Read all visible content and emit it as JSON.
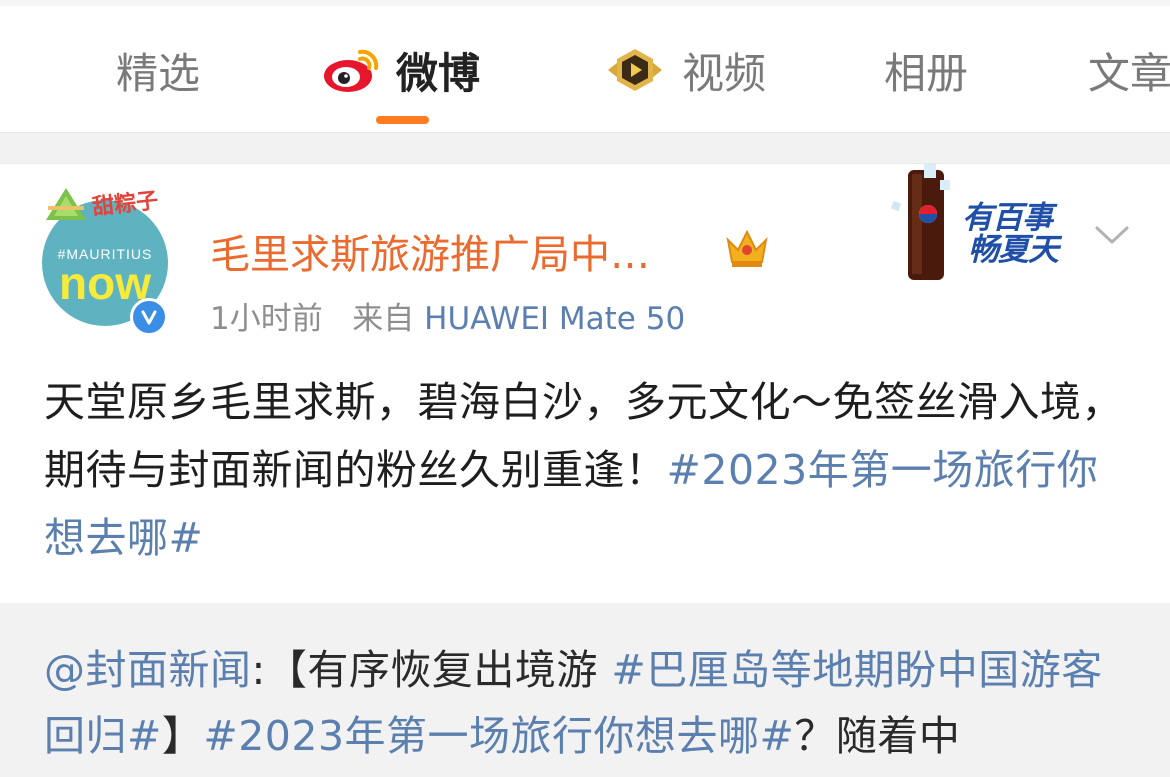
{
  "tabs": [
    {
      "label": "精选",
      "active": false,
      "icon": null
    },
    {
      "label": "微博",
      "active": true,
      "icon": "weibo-logo-icon"
    },
    {
      "label": "视频",
      "active": false,
      "icon": "video-play-badge-icon"
    },
    {
      "label": "相册",
      "active": false,
      "icon": null
    },
    {
      "label": "文章",
      "active": false,
      "icon": null
    }
  ],
  "post": {
    "avatar": {
      "line1": "#MAURITIUS",
      "line2": "now",
      "badge_text": "甜粽子",
      "verified_icon": "verified-check-icon"
    },
    "username": "毛里求斯旅游推广局中…",
    "username_badge_icon": "crown-level-icon",
    "time": "1小时前",
    "source_prefix": "来自",
    "device": "HUAWEI Mate 50",
    "ad_banner": {
      "line1": "有百事",
      "line2": "畅夏天"
    },
    "more_icon": "chevron-down-icon",
    "text_plain": "天堂原乡毛里求斯，碧海白沙，多元文化～免签丝滑入境，期待与封面新闻的粉丝久别重逢！",
    "text_hashtag": "#2023年第一场旅行你想去哪#"
  },
  "repost": {
    "mention": "@封面新闻",
    "colon": ":【有序恢复出境游 ",
    "hashtag1": "#巴厘岛等地期盼中国游客回归#",
    "bracket": "】",
    "hashtag2": "#2023年第一场旅行你想去哪#",
    "tail": "？随着中"
  },
  "colors": {
    "accent": "#ff7b1f",
    "username": "#eb6a2e",
    "link": "#5b7fae",
    "verified": "#3a8ee6"
  }
}
